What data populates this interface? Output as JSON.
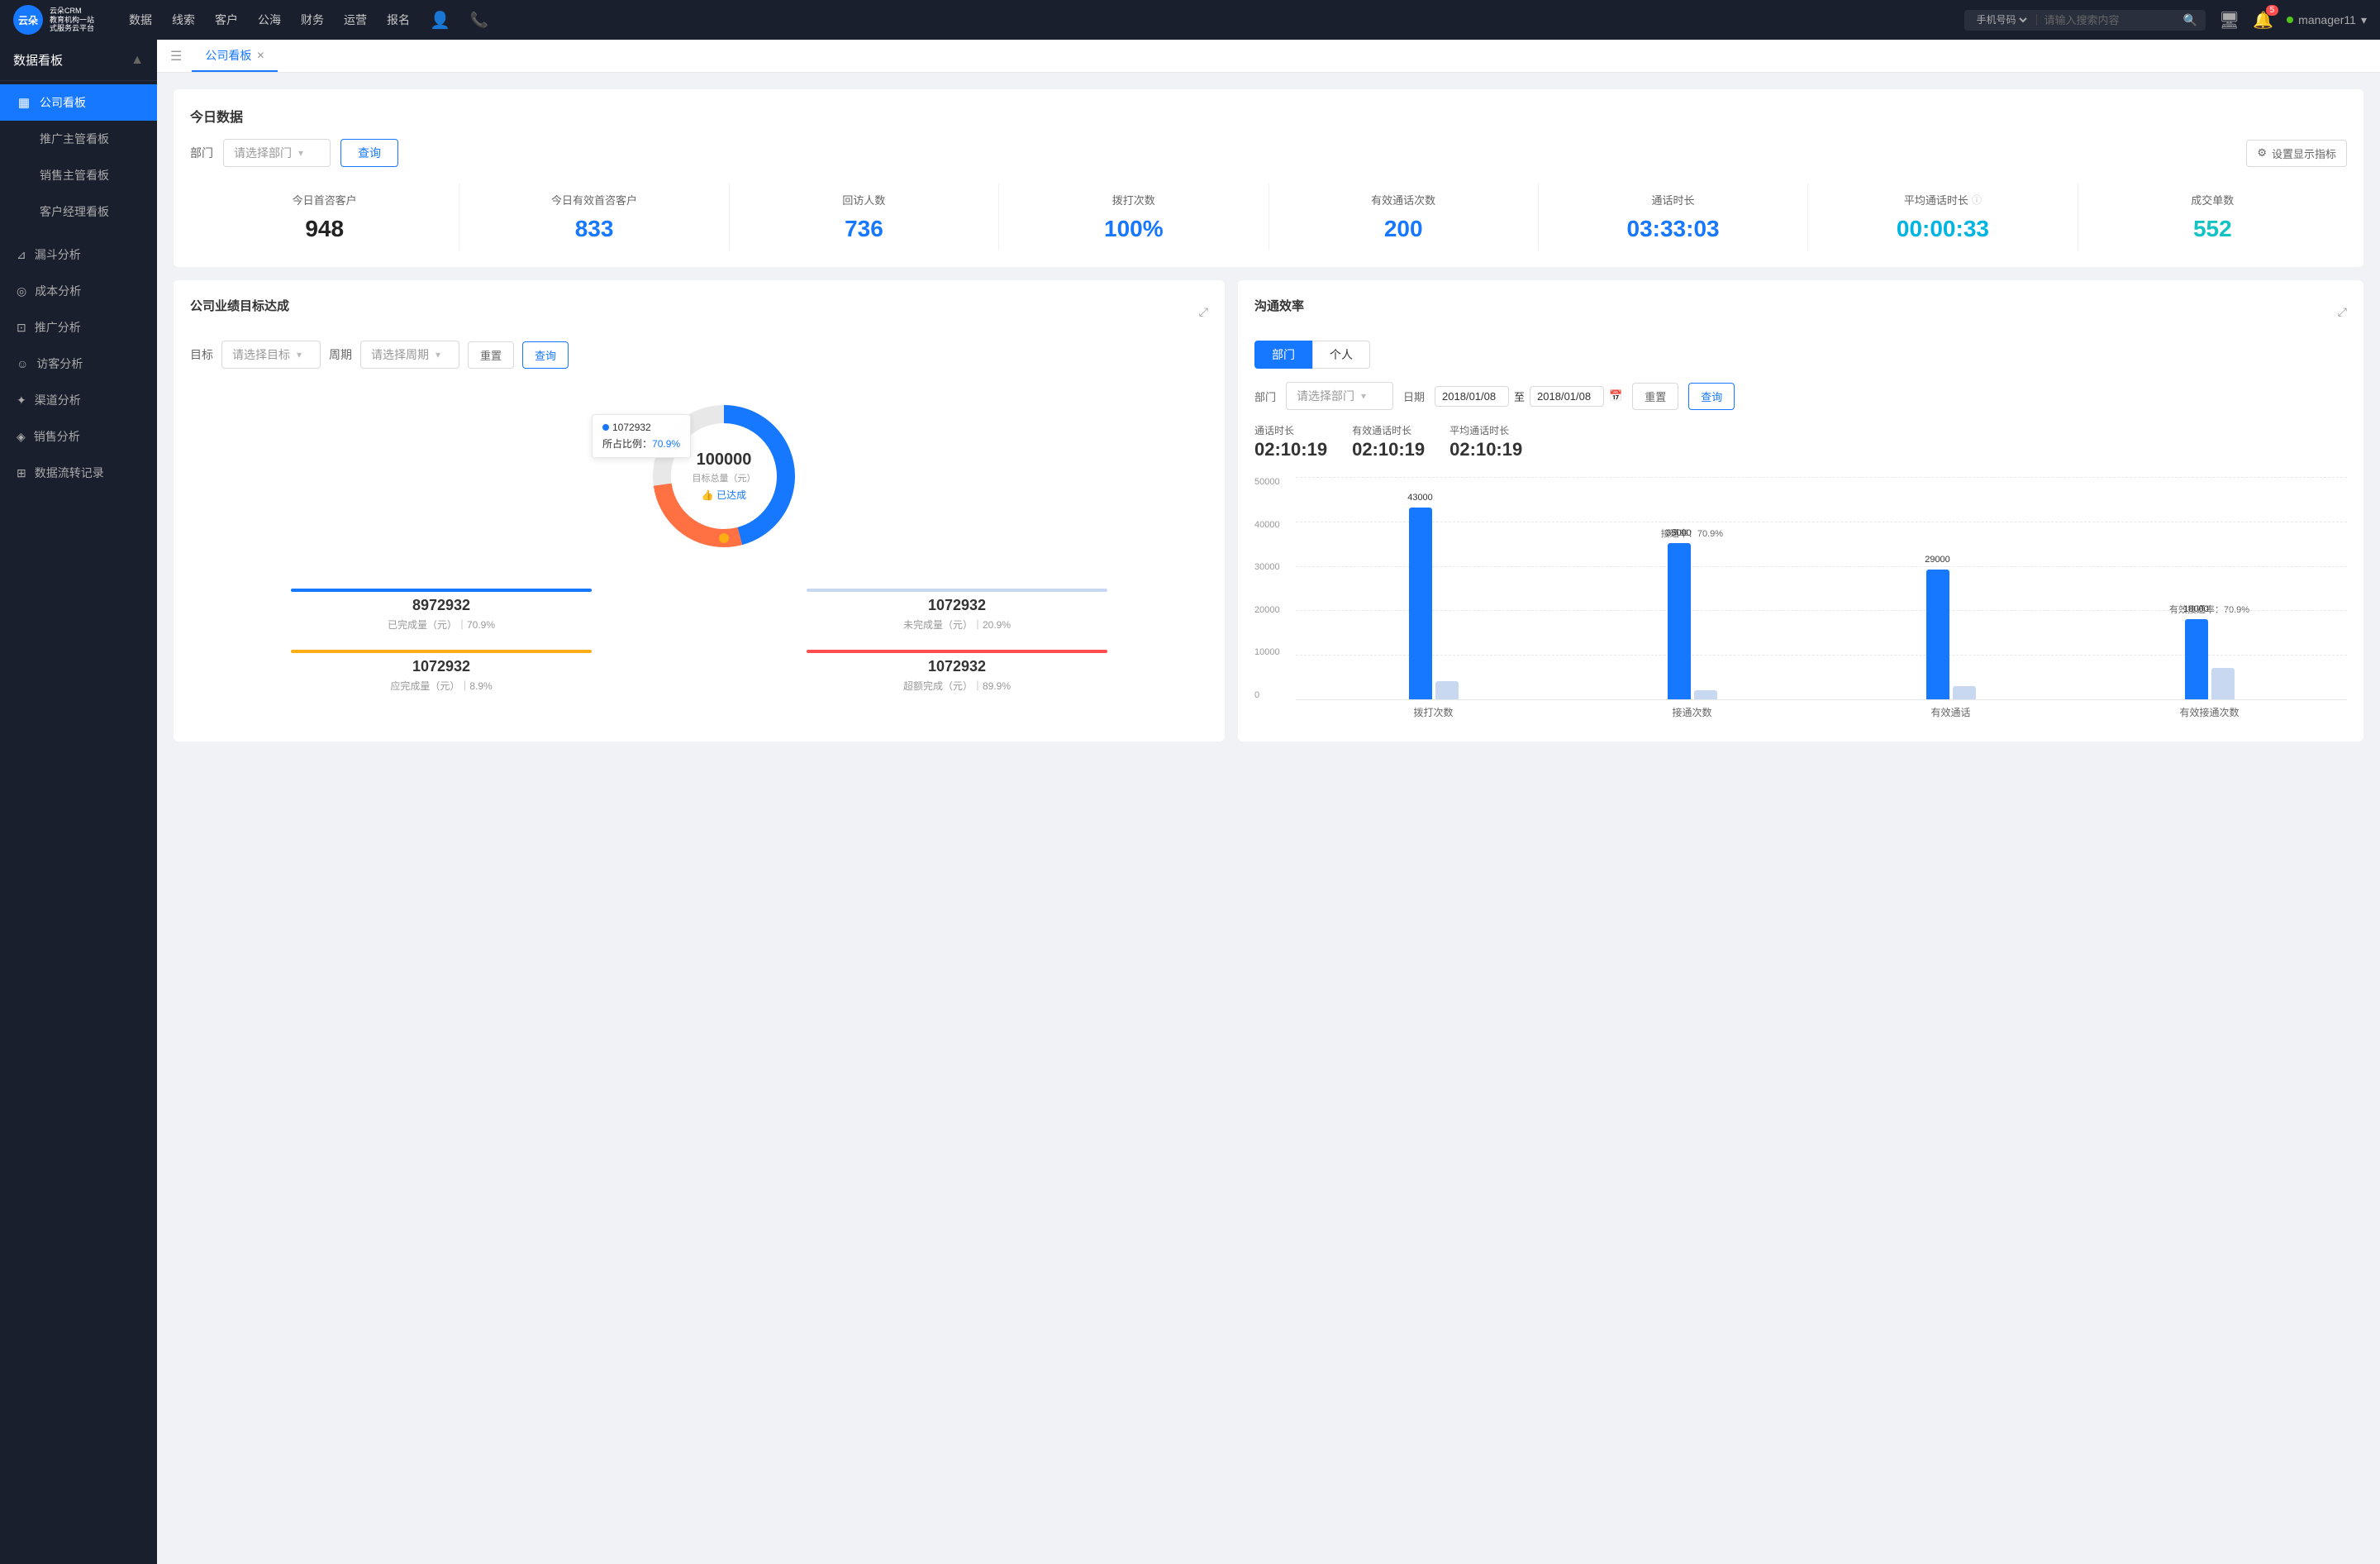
{
  "topNav": {
    "logo": {
      "text": "云朵CRM\n教育机构一站\n式服务云平台"
    },
    "navItems": [
      "数据",
      "线索",
      "客户",
      "公海",
      "财务",
      "运营",
      "报名"
    ],
    "search": {
      "selectLabel": "手机号码",
      "placeholder": "请输入搜索内容"
    },
    "bellBadge": "5",
    "userName": "manager11"
  },
  "sidebar": {
    "title": "数据看板",
    "items": [
      {
        "label": "公司看板",
        "active": true,
        "icon": "▦"
      },
      {
        "label": "推广主管看板",
        "active": false,
        "icon": ""
      },
      {
        "label": "销售主管看板",
        "active": false,
        "icon": ""
      },
      {
        "label": "客户经理看板",
        "active": false,
        "icon": ""
      }
    ],
    "groups": [
      {
        "label": "漏斗分析",
        "icon": "⊿"
      },
      {
        "label": "成本分析",
        "icon": "◎"
      },
      {
        "label": "推广分析",
        "icon": "⊡"
      },
      {
        "label": "访客分析",
        "icon": "☺"
      },
      {
        "label": "渠道分析",
        "icon": "✦"
      },
      {
        "label": "销售分析",
        "icon": "◈"
      },
      {
        "label": "数据流转记录",
        "icon": "⊞"
      }
    ]
  },
  "tabBar": {
    "tabs": [
      {
        "label": "公司看板",
        "closable": true
      }
    ]
  },
  "todayData": {
    "sectionTitle": "今日数据",
    "filterLabel": "部门",
    "selectPlaceholder": "请选择部门",
    "queryBtn": "查询",
    "settingsBtn": "设置显示指标",
    "stats": [
      {
        "label": "今日首咨客户",
        "value": "948",
        "color": "black"
      },
      {
        "label": "今日有效首咨客户",
        "value": "833",
        "color": "blue"
      },
      {
        "label": "回访人数",
        "value": "736",
        "color": "blue"
      },
      {
        "label": "拨打次数",
        "value": "100%",
        "color": "blue"
      },
      {
        "label": "有效通话次数",
        "value": "200",
        "color": "blue"
      },
      {
        "label": "通话时长",
        "value": "03:33:03",
        "color": "blue"
      },
      {
        "label": "平均通话时长",
        "value": "00:00:33",
        "color": "cyan"
      },
      {
        "label": "成交单数",
        "value": "552",
        "color": "teal"
      }
    ]
  },
  "targetPanel": {
    "title": "公司业绩目标达成",
    "targetLabel": "目标",
    "targetPlaceholder": "请选择目标",
    "periodLabel": "周期",
    "periodPlaceholder": "请选择周期",
    "resetBtn": "重置",
    "queryBtn": "查询",
    "donut": {
      "value": "100000",
      "subLabel": "目标总量（元）",
      "badge": "👍 已达成",
      "tooltip": {
        "title": "1072932",
        "percentLabel": "所占比例：",
        "percent": "70.9%"
      }
    },
    "stats": [
      {
        "value": "8972932",
        "desc": "已完成量（元）｜70.9%",
        "barClass": "completed"
      },
      {
        "value": "1072932",
        "desc": "未完成量（元）｜20.9%",
        "barClass": "uncompleted"
      },
      {
        "value": "1072932",
        "desc": "应完成量（元）｜8.9%",
        "barClass": "should"
      },
      {
        "value": "1072932",
        "desc": "超额完成（元）｜89.9%",
        "barClass": "over"
      }
    ]
  },
  "commPanel": {
    "title": "沟通效率",
    "tabs": [
      "部门",
      "个人"
    ],
    "activeTab": 0,
    "filterLabel": "部门",
    "deptPlaceholder": "请选择部门",
    "dateLabel": "日期",
    "dateFrom": "2018/01/08",
    "dateTo": "2018/01/08",
    "resetBtn": "重置",
    "queryBtn": "查询",
    "commStats": [
      {
        "label": "通话时长",
        "value": "02:10:19"
      },
      {
        "label": "有效通话时长",
        "value": "02:10:19"
      },
      {
        "label": "平均通话时长",
        "value": "02:10:19"
      }
    ],
    "chart": {
      "yLabels": [
        "0",
        "10000",
        "20000",
        "30000",
        "40000",
        "50000"
      ],
      "groups": [
        {
          "xLabel": "拨打次数",
          "rateLabel": "",
          "bars": [
            {
              "value": 43000,
              "color": "#1677ff",
              "label": "43000",
              "heightPct": 86
            },
            {
              "value": 0,
              "color": "#c8d8f0",
              "label": "",
              "heightPct": 8
            }
          ]
        },
        {
          "xLabel": "接通次数",
          "rateLabel": "接通率：70.9%",
          "bars": [
            {
              "value": 35000,
              "color": "#1677ff",
              "label": "35000",
              "heightPct": 70
            },
            {
              "value": 0,
              "color": "#c8d8f0",
              "label": "",
              "heightPct": 4
            }
          ]
        },
        {
          "xLabel": "有效通话",
          "rateLabel": "",
          "bars": [
            {
              "value": 29000,
              "color": "#1677ff",
              "label": "29000",
              "heightPct": 58
            },
            {
              "value": 0,
              "color": "#c8d8f0",
              "label": "",
              "heightPct": 6
            }
          ]
        },
        {
          "xLabel": "有效接通次数",
          "rateLabel": "有效接通率：70.9%",
          "bars": [
            {
              "value": 18000,
              "color": "#1677ff",
              "label": "18000",
              "heightPct": 36
            },
            {
              "value": 0,
              "color": "#c8d8f0",
              "label": "",
              "heightPct": 14
            }
          ]
        }
      ]
    }
  }
}
